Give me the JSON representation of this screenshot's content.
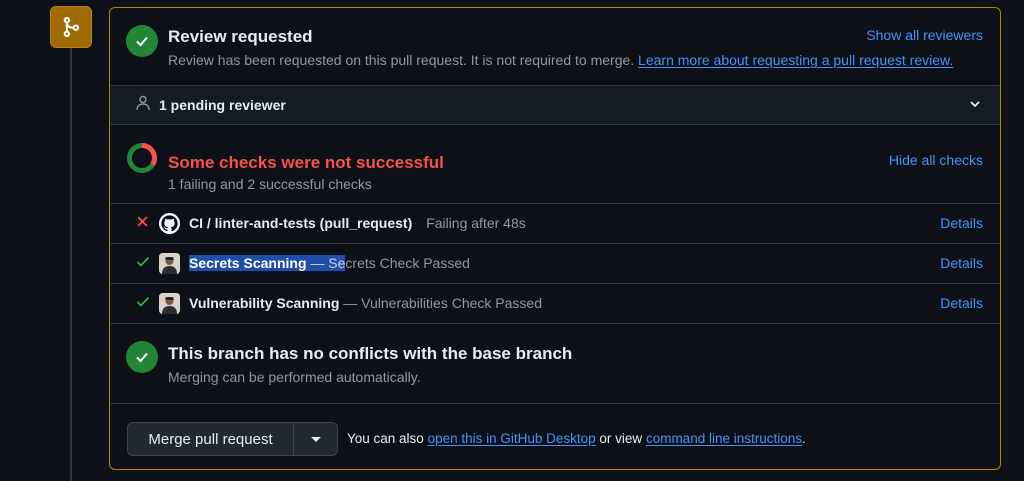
{
  "review": {
    "title": "Review requested",
    "description": "Review has been requested on this pull request. It is not required to merge.",
    "learn_more_link": "Learn more about requesting a pull request review.",
    "show_all_reviewers": "Show all reviewers"
  },
  "pending": {
    "label": "1 pending reviewer"
  },
  "checks": {
    "title": "Some checks were not successful",
    "summary": "1 failing and 2 successful checks",
    "hide_all": "Hide all checks",
    "items": [
      {
        "status": "failure",
        "name": "CI / linter-and-tests (pull_request)",
        "description": "Failing after 48s",
        "details": "Details",
        "icon": "github-logo-icon"
      },
      {
        "status": "success",
        "name": "Secrets Scanning",
        "description_highlighted": " — Se",
        "description_rest": "crets Check Passed",
        "details": "Details",
        "icon": "avatar-icon"
      },
      {
        "status": "success",
        "name": "Vulnerability Scanning",
        "description": " — Vulnerabilities Check Passed",
        "details": "Details",
        "icon": "avatar-icon"
      }
    ]
  },
  "conflicts": {
    "title": "This branch has no conflicts with the base branch",
    "subtitle": "Merging can be performed automatically."
  },
  "merge": {
    "button_label": "Merge pull request",
    "note_prefix": "You can also ",
    "desktop_link": "open this in GitHub Desktop",
    "note_middle": " or view ",
    "cli_link": "command line instructions",
    "note_suffix": "."
  },
  "colors": {
    "success": "#238636",
    "failure": "#f85149",
    "accent_link": "#4493f8",
    "attention_border": "#bb8009",
    "merge_badge": "#9e6a03"
  }
}
